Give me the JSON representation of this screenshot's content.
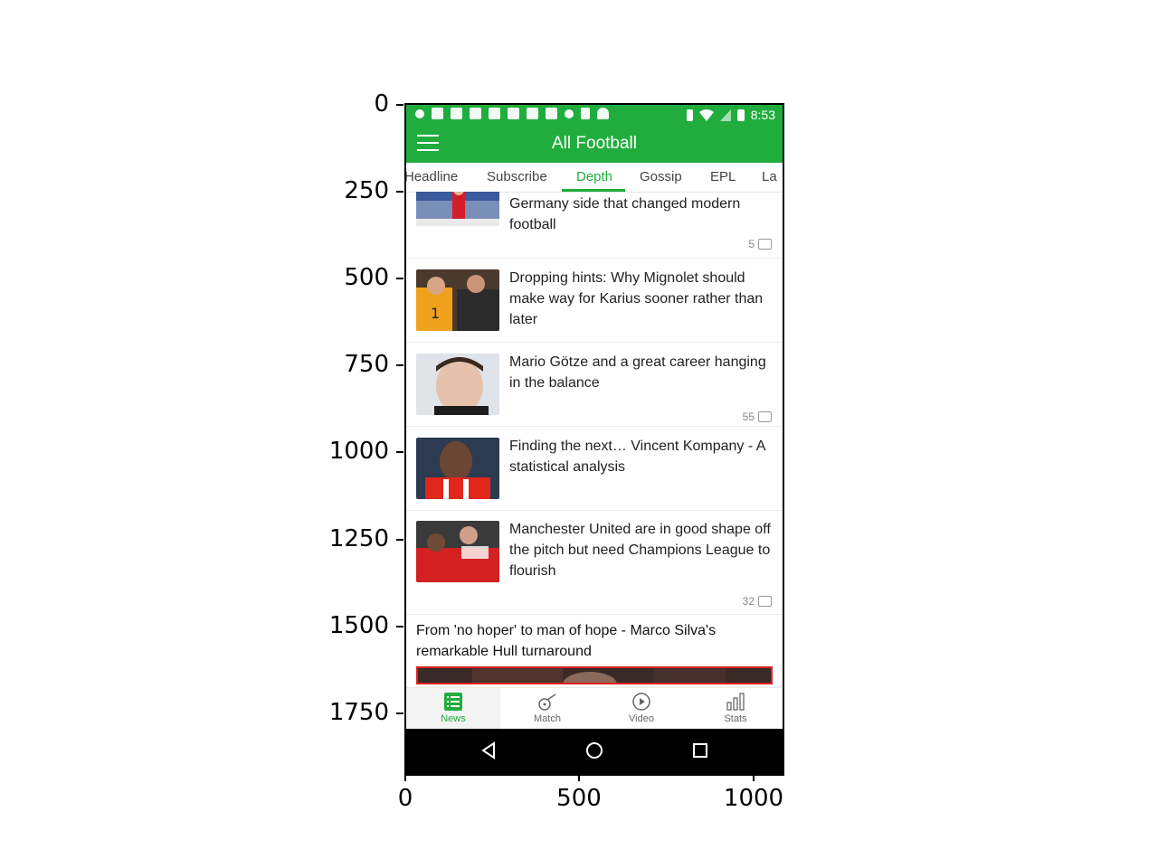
{
  "axes": {
    "y_ticks": [
      "0",
      "250",
      "500",
      "750",
      "1000",
      "1250",
      "1500",
      "1750"
    ],
    "x_ticks": [
      "0",
      "500",
      "1000"
    ]
  },
  "status_bar": {
    "time": "8:53"
  },
  "app_bar": {
    "title": "All Football",
    "menu_icon": "hamburger-menu-icon"
  },
  "tabs": [
    {
      "label": "Headline"
    },
    {
      "label": "Subscribe"
    },
    {
      "label": "Depth",
      "active": true
    },
    {
      "label": "Gossip"
    },
    {
      "label": "EPL"
    },
    {
      "label": "La"
    }
  ],
  "feed": {
    "items": [
      {
        "headline": "Germany side that changed modern football",
        "comments": "5"
      },
      {
        "headline": "Dropping hints: Why Mignolet should make way for Karius sooner rather than later",
        "comments": ""
      },
      {
        "headline": "Mario Götze and a great career hanging in the balance",
        "comments": "55"
      },
      {
        "headline": "Finding the next… Vincent Kompany - A statistical analysis",
        "comments": ""
      },
      {
        "headline": "Manchester United are in good shape off the pitch but need Champions League to flourish",
        "comments": "32"
      }
    ],
    "featured": {
      "headline": "From 'no hoper' to man of hope - Marco Silva's remarkable Hull turnaround"
    }
  },
  "bottom_nav": [
    {
      "label": "News",
      "icon": "news-list-icon",
      "active": true
    },
    {
      "label": "Match",
      "icon": "whistle-icon"
    },
    {
      "label": "Video",
      "icon": "play-circle-icon"
    },
    {
      "label": "Stats",
      "icon": "bar-chart-icon"
    }
  ],
  "colors": {
    "brand": "#20ad3e",
    "highlight_box": "#e0201f"
  }
}
